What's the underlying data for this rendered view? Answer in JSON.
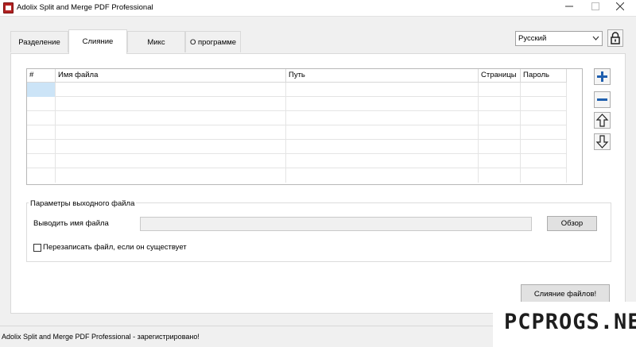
{
  "window": {
    "title": "Adolix Split and Merge PDF Professional",
    "minimize_icon": "minimize-icon",
    "maximize_icon": "maximize-icon",
    "close_icon": "close-icon"
  },
  "tabs": [
    {
      "label": "Разделение",
      "active": false
    },
    {
      "label": "Слияние",
      "active": true
    },
    {
      "label": "Микс",
      "active": false
    },
    {
      "label": "О программе",
      "active": false
    }
  ],
  "language": {
    "selected": "Русский",
    "icon": "chevron-down-icon"
  },
  "lock_icon": "lock-icon",
  "table": {
    "columns": [
      "#",
      "Имя файла",
      "Путь",
      "Страницы",
      "Пароль"
    ],
    "rows": []
  },
  "side_buttons": {
    "add": "plus-icon",
    "remove": "minus-icon",
    "move_up": "arrow-up-icon",
    "move_down": "arrow-down-icon"
  },
  "output": {
    "group_title": "Параметры выходного файла",
    "filename_label": "Выводить имя файла",
    "filename_value": "",
    "browse_label": "Обзор",
    "overwrite_label": "Перезаписать файл, если он существует",
    "overwrite_checked": false
  },
  "merge_button": "Слияние файлов!",
  "status": "Adolix Split and Merge PDF Professional - зарегистрировано!",
  "watermark": "PCPROGS.NET"
}
